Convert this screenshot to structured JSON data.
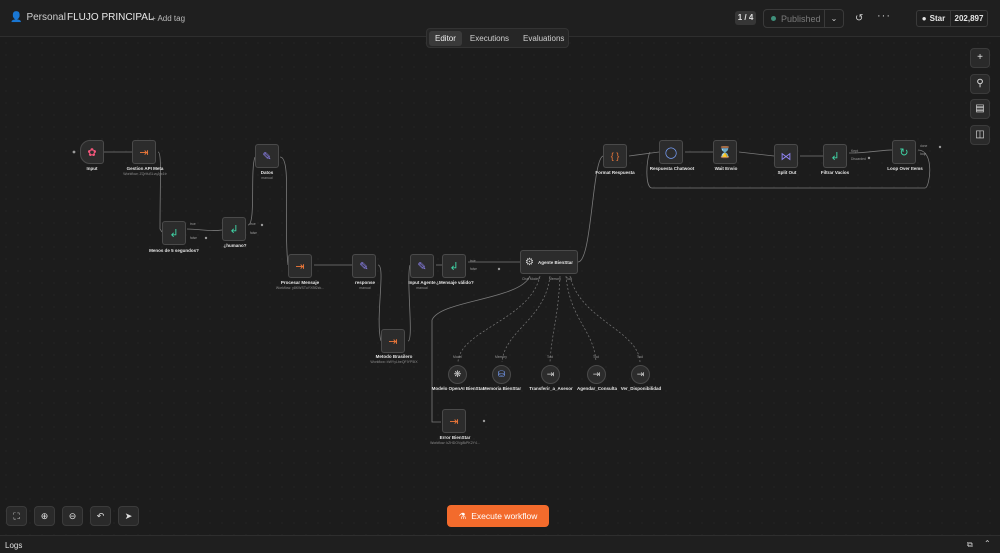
{
  "header": {
    "workspace": "Personal",
    "workflow_title": "FLUJO PRINCIPAL",
    "add_tag": "+ Add tag",
    "pager": "1 / 4",
    "published_label": "Published",
    "star_label": "Star",
    "star_count": "202,897"
  },
  "tabs": [
    {
      "label": "Editor"
    },
    {
      "label": "Executions"
    },
    {
      "label": "Evaluations"
    }
  ],
  "nodes": {
    "input": {
      "label": "Input",
      "icon": "webhook-icon"
    },
    "gestion": {
      "label": "Gestion API Meta",
      "sub": "Workflow: ZQrIfuSLvqJyx1tr"
    },
    "menos5": {
      "label": "Menos de 5 segundos?"
    },
    "humano": {
      "label": "¿humano?"
    },
    "datos": {
      "label": "Datos",
      "sub": "manual"
    },
    "procesar": {
      "label": "Procesar Mensaje",
      "sub": "Workflow: y8KWSTuYXBf2zk..."
    },
    "response": {
      "label": "response",
      "sub": "manual"
    },
    "metodo": {
      "label": "Metodo Brasilero",
      "sub": "Workflow: bWYyLbeQFIYP5IX"
    },
    "inputAgente": {
      "label": "Input Agente",
      "sub": "manual"
    },
    "mensajeValido": {
      "label": "¿Mensaje válido?"
    },
    "agente": {
      "label": "Agente BienStar"
    },
    "format": {
      "label": "Format Respuesta"
    },
    "respuesta": {
      "label": "Respuesta Chatwoot"
    },
    "wait": {
      "label": "Wait Envio"
    },
    "split": {
      "label": "Split Out"
    },
    "filtrar": {
      "label": "Filtrar Vacíos"
    },
    "loop": {
      "label": "Loop Over Items"
    },
    "modelo": {
      "label": "Modelo OpenAI BienStar",
      "port": "Model"
    },
    "memoria": {
      "label": "Memoria BienStar",
      "port": "Memory"
    },
    "transferir": {
      "label": "Transferir_a_Asesor",
      "port": "Tool"
    },
    "agendar": {
      "label": "Agendar_Consulta",
      "port": "Tool"
    },
    "ver": {
      "label": "Ver_Disponibilidad",
      "port": "Tool"
    },
    "error": {
      "label": "Error BienStar",
      "sub": "Workflow: kZHDOVg8kPK2Y4..."
    }
  },
  "ports": {
    "true": "true",
    "false": "false",
    "done": "done",
    "loop": "loop",
    "kept": "Kept",
    "discarded": "Discarded",
    "chat_model": "Chat Model*",
    "memory": "Memory",
    "tool": "Tool"
  },
  "actions": {
    "execute": "Execute workflow"
  },
  "logs": {
    "label": "Logs"
  },
  "colors": {
    "accent": "#f36b2c",
    "published_dot": "#3f8f7a",
    "switch_green": "#3fd2a4",
    "form_purple": "#8f84f2"
  }
}
